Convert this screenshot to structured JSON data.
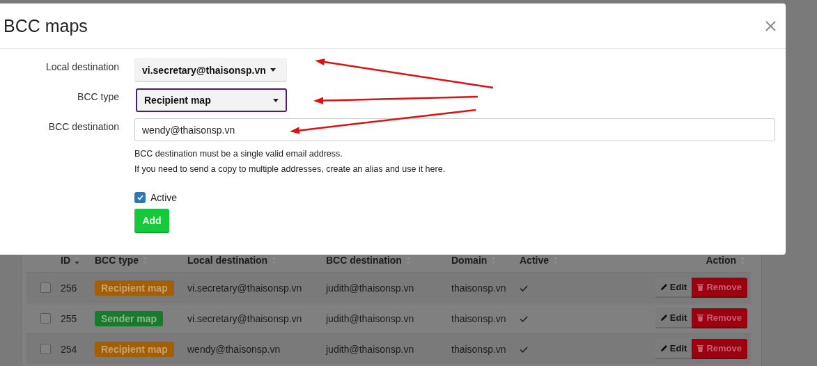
{
  "modal": {
    "title": "BCC maps",
    "fields": [
      {
        "kind": "dropdown",
        "label": "Local destination",
        "value": "vi.secretary@thaisonsp.vn",
        "focused": false
      },
      {
        "kind": "select",
        "label": "BCC type",
        "value": "Recipient map",
        "focused": true
      },
      {
        "kind": "input",
        "label": "BCC destination",
        "value": "wendy@thaisonsp.vn",
        "focused": false
      }
    ],
    "help": [
      "BCC destination must be a single valid email address.",
      "If you need to send a copy to multiple addresses, create an alias and use it here."
    ],
    "active": {
      "label": "Active",
      "checked": true
    },
    "add_button": "Add"
  },
  "table": {
    "columns": [
      {
        "label": "ID",
        "sorted": true
      },
      {
        "label": "BCC type",
        "sorted": false
      },
      {
        "label": "Local destination",
        "sorted": false
      },
      {
        "label": "BCC destination",
        "sorted": false
      },
      {
        "label": "Domain",
        "sorted": false
      },
      {
        "label": "Active",
        "sorted": false
      },
      {
        "label": "Action",
        "sorted": false
      }
    ],
    "rows": [
      {
        "checked": false,
        "id": "256",
        "bcc_type": {
          "label": "Recipient map",
          "kind": "recipient"
        },
        "local_destination": "vi.secretary@thaisonsp.vn",
        "bcc_destination": "judith@thaisonsp.vn",
        "domain": "thaisonsp.vn",
        "active": true,
        "edit": "Edit",
        "remove": "Remove"
      },
      {
        "checked": false,
        "id": "255",
        "bcc_type": {
          "label": "Sender map",
          "kind": "sender"
        },
        "local_destination": "vi.secretary@thaisonsp.vn",
        "bcc_destination": "judith@thaisonsp.vn",
        "domain": "thaisonsp.vn",
        "active": true,
        "edit": "Edit",
        "remove": "Remove"
      },
      {
        "checked": false,
        "id": "254",
        "bcc_type": {
          "label": "Recipient map",
          "kind": "recipient"
        },
        "local_destination": "wendy@thaisonsp.vn",
        "bcc_destination": "judith@thaisonsp.vn",
        "domain": "thaisonsp.vn",
        "active": true,
        "edit": "Edit",
        "remove": "Remove"
      }
    ]
  }
}
